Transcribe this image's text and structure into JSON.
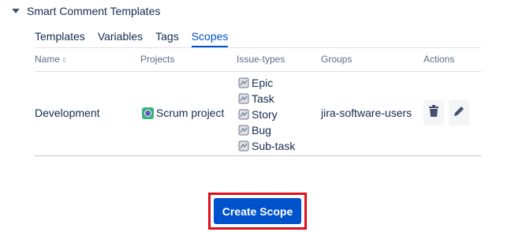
{
  "section": {
    "title": "Smart Comment Templates"
  },
  "tabs": [
    {
      "label": "Templates",
      "active": false
    },
    {
      "label": "Variables",
      "active": false
    },
    {
      "label": "Tags",
      "active": false
    },
    {
      "label": "Scopes",
      "active": true
    }
  ],
  "table": {
    "columns": [
      "Name",
      "Projects",
      "Issue-types",
      "Groups",
      "Actions"
    ],
    "rows": [
      {
        "name": "Development",
        "project": "Scrum project",
        "issue_types": [
          "Epic",
          "Task",
          "Story",
          "Bug",
          "Sub-task"
        ],
        "group": "jira-software-users",
        "actions": [
          "trash-icon",
          "pencil-icon"
        ]
      }
    ]
  },
  "cta": {
    "label": "Create Scope"
  },
  "colors": {
    "accent": "#0052cc",
    "highlight": "#e0101b",
    "text": "#172b4d",
    "muted": "#5e6c84"
  }
}
